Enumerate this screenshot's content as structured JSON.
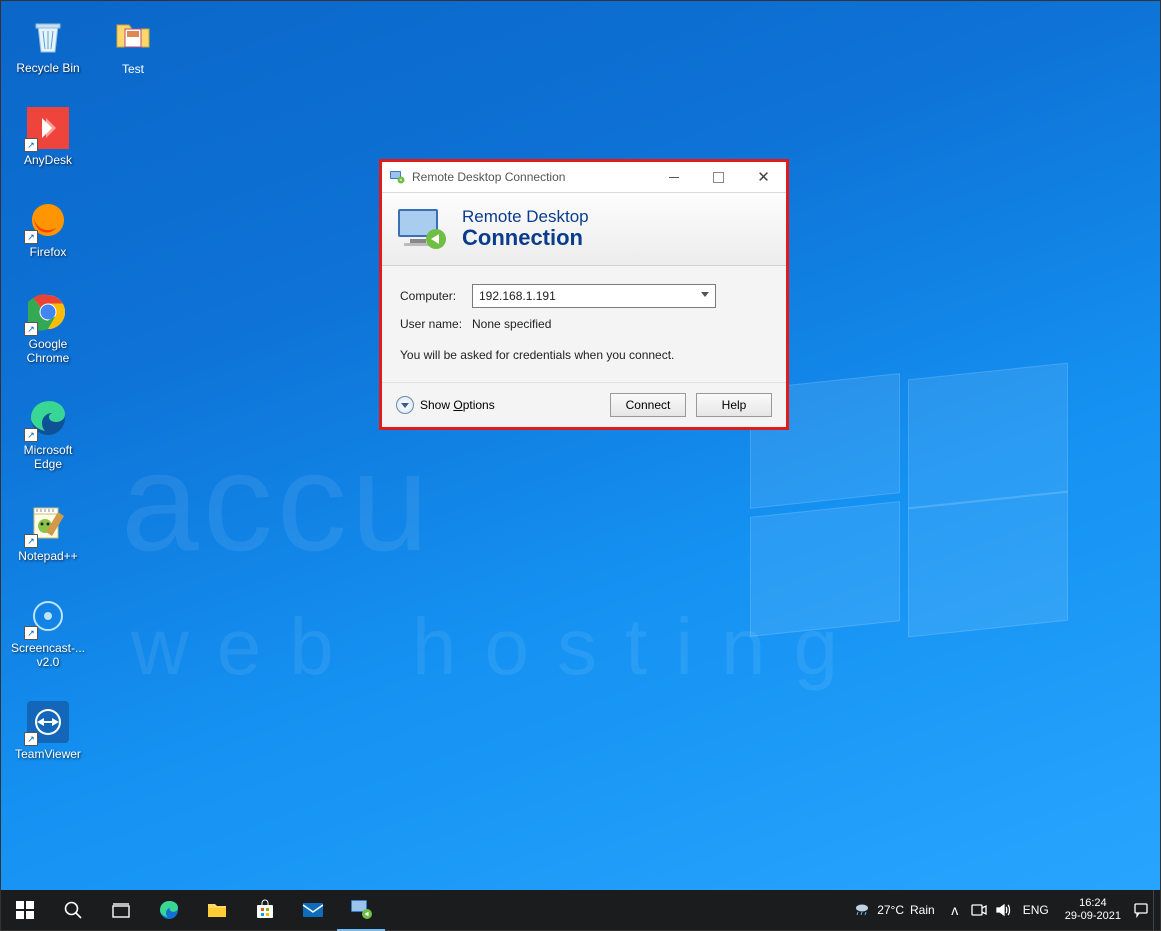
{
  "desktop_icons": [
    {
      "id": "recycle-bin",
      "label": "Recycle Bin"
    },
    {
      "id": "anydesk",
      "label": "AnyDesk"
    },
    {
      "id": "firefox",
      "label": "Firefox"
    },
    {
      "id": "google-chrome",
      "label": "Google\nChrome"
    },
    {
      "id": "microsoft-edge",
      "label": "Microsoft\nEdge"
    },
    {
      "id": "notepadpp",
      "label": "Notepad++"
    },
    {
      "id": "screencast",
      "label": "Screencast-...\nv2.0"
    },
    {
      "id": "teamviewer",
      "label": "TeamViewer"
    }
  ],
  "desktop_icon_test": {
    "label": "Test"
  },
  "watermark": {
    "line1": "accu",
    "line2": "web hosting"
  },
  "rdc": {
    "title": "Remote Desktop Connection",
    "banner_line1": "Remote Desktop",
    "banner_line2": "Connection",
    "computer_label": "Computer:",
    "computer_value": "192.168.1.191",
    "username_label": "User name:",
    "username_value": "None specified",
    "note": "You will be asked for credentials when you connect.",
    "show_options": "Show Options",
    "connect": "Connect",
    "help": "Help"
  },
  "taskbar": {
    "weather_temp": "27°C",
    "weather_text": "Rain",
    "lang": "ENG",
    "time": "16:24",
    "date": "29-09-2021"
  }
}
